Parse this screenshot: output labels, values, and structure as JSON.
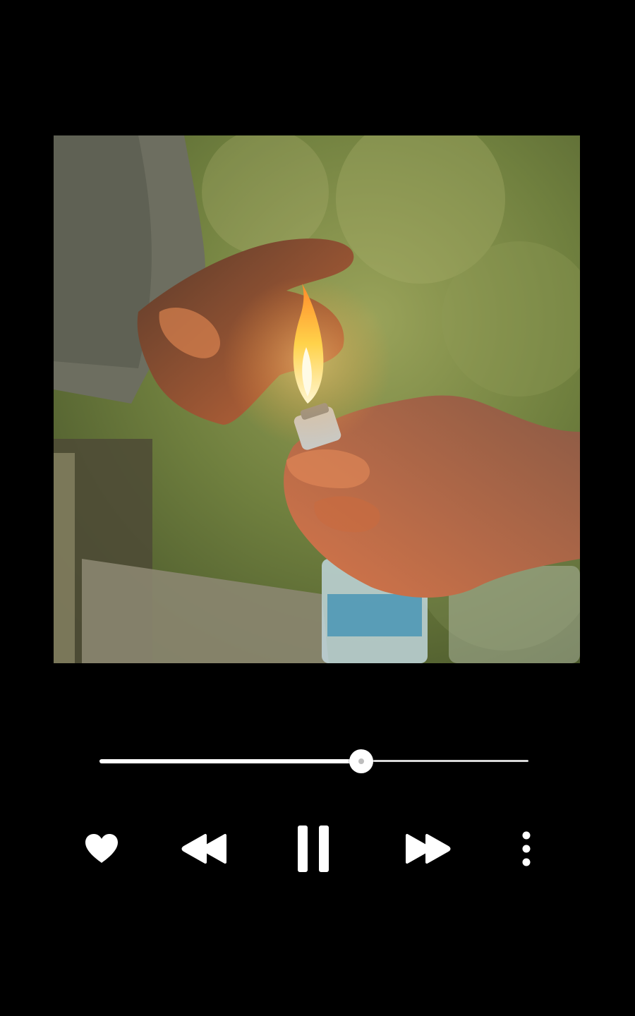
{
  "player": {
    "artwork": {
      "icon": "album-cover-image"
    },
    "progress": {
      "fraction": 0.61
    },
    "controls": {
      "like": {
        "icon": "heart-icon"
      },
      "previous": {
        "icon": "rewind-icon"
      },
      "play_pause": {
        "icon": "pause-icon",
        "state": "playing"
      },
      "next": {
        "icon": "fast-forward-icon"
      },
      "more": {
        "icon": "more-vertical-icon"
      }
    }
  },
  "colors": {
    "background": "#000000",
    "controls": "#ffffff",
    "track": "#d9d9d9"
  }
}
